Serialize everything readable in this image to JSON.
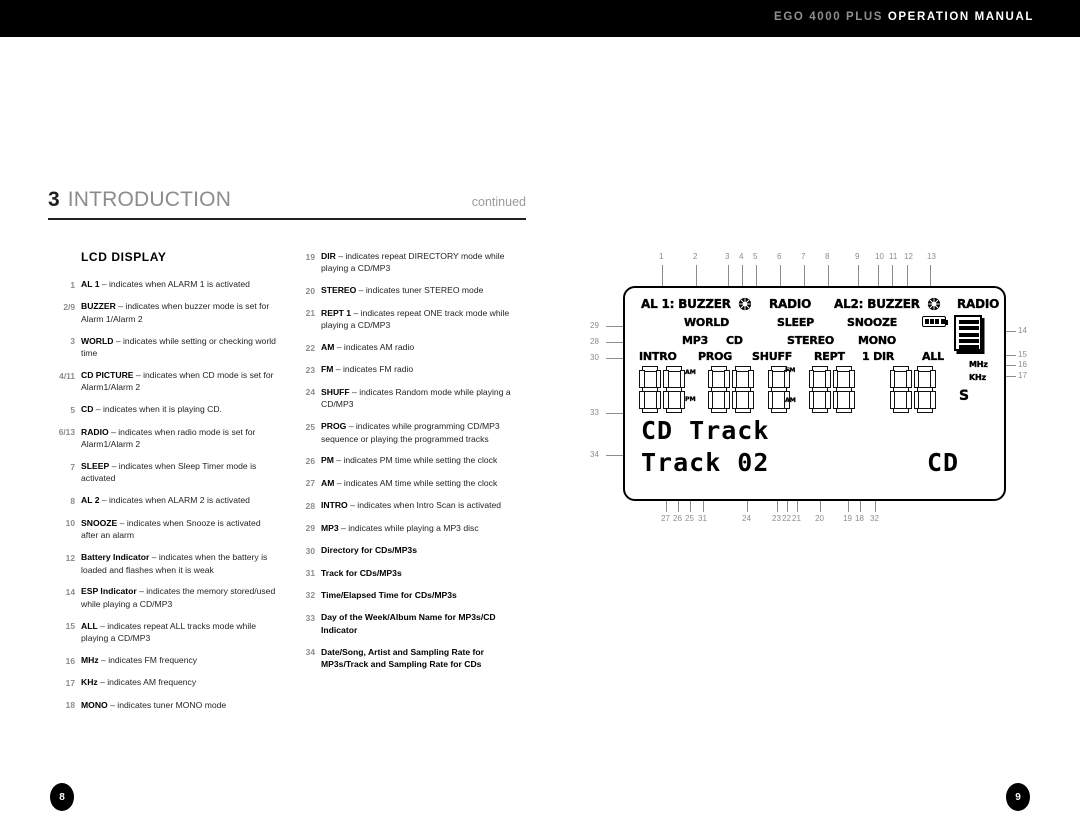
{
  "header": {
    "brand": "EGO 4000 PLUS",
    "title": "OPERATION MANUAL"
  },
  "section": {
    "number": "3",
    "title": "INTRODUCTION",
    "continued": "continued"
  },
  "left_column": {
    "heading": "LCD DISPLAY",
    "items": [
      {
        "num": "1",
        "term": "AL 1",
        "rest": " – indicates when ALARM 1 is activated"
      },
      {
        "num": "2/9",
        "term": "BUZZER",
        "rest": " – indicates when buzzer mode is set for Alarm 1/Alarm 2"
      },
      {
        "num": "3",
        "term": "WORLD",
        "rest": " – indicates while setting or checking world time"
      },
      {
        "num": "4/11",
        "term": "CD PICTURE",
        "rest": " – indicates when CD mode is set for Alarm1/Alarm 2"
      },
      {
        "num": "5",
        "term": "CD",
        "rest": " – indicates when it is playing CD."
      },
      {
        "num": "6/13",
        "term": "RADIO",
        "rest": " – indicates when radio mode is set for Alarm1/Alarm 2"
      },
      {
        "num": "7",
        "term": "SLEEP",
        "rest": " – indicates when Sleep Timer mode is activated"
      },
      {
        "num": "8",
        "term": "AL 2",
        "rest": " – indicates when ALARM 2 is activated"
      },
      {
        "num": "10",
        "term": "SNOOZE",
        "rest": " – indicates when Snooze is activated after an alarm"
      },
      {
        "num": "12",
        "term": "Battery Indicator",
        "rest": " – indicates when the battery is loaded and flashes when it is weak"
      },
      {
        "num": "14",
        "term": "ESP Indicator",
        "rest": " – indicates the memory stored/used while playing a CD/MP3"
      },
      {
        "num": "15",
        "term": "ALL",
        "rest": " – indicates repeat ALL tracks mode while playing a CD/MP3"
      },
      {
        "num": "16",
        "term": "MHz",
        "rest": " – indicates FM frequency"
      },
      {
        "num": "17",
        "term": "KHz",
        "rest": " – indicates AM frequency"
      },
      {
        "num": "18",
        "term": "MONO",
        "rest": " – indicates tuner MONO mode"
      }
    ]
  },
  "middle_column": {
    "items": [
      {
        "num": "19",
        "term": "DIR",
        "rest": " – indicates repeat DIRECTORY mode while playing a CD/MP3"
      },
      {
        "num": "20",
        "term": "STEREO",
        "rest": " – indicates tuner STEREO mode"
      },
      {
        "num": "21",
        "term": "REPT 1",
        "rest": " – indicates repeat ONE track mode while playing a CD/MP3"
      },
      {
        "num": "22",
        "term": "AM",
        "rest": " – indicates AM radio"
      },
      {
        "num": "23",
        "term": "FM",
        "rest": " – indicates FM radio"
      },
      {
        "num": "24",
        "term": "SHUFF",
        "rest": " – indicates Random mode while playing a CD/MP3"
      },
      {
        "num": "25",
        "term": "PROG",
        "rest": " – indicates while programming CD/MP3 sequence or playing the programmed tracks"
      },
      {
        "num": "26",
        "term": "PM",
        "rest": " – indicates PM time while setting the clock"
      },
      {
        "num": "27",
        "term": "AM",
        "rest": " – indicates AM time while setting the clock"
      },
      {
        "num": "28",
        "term": "INTRO",
        "rest": " – indicates when Intro Scan is activated"
      },
      {
        "num": "29",
        "term": "MP3",
        "rest": " – indicates while playing a MP3 disc"
      },
      {
        "num": "30",
        "term": "Directory for CDs/MP3s",
        "rest": ""
      },
      {
        "num": "31",
        "term": "Track for CDs/MP3s",
        "rest": ""
      },
      {
        "num": "32",
        "term": "Time/Elapsed Time for CDs/MP3s",
        "rest": ""
      },
      {
        "num": "33",
        "term": "Day of the Week/Album Name for MP3s/CD Indicator",
        "rest": ""
      },
      {
        "num": "34",
        "term": "Date/Song, Artist and Sampling Rate for MP3s/Track and Sampling Rate for CDs",
        "rest": ""
      }
    ]
  },
  "lcd_diagram": {
    "callouts_top": [
      "1",
      "2",
      "3",
      "4",
      "5",
      "6",
      "7",
      "8",
      "9",
      "10",
      "11",
      "12",
      "13"
    ],
    "callouts_left": [
      "29",
      "28",
      "30",
      "33",
      "34"
    ],
    "callouts_right": [
      "14",
      "15",
      "16",
      "17"
    ],
    "callouts_bottom": [
      "27",
      "26",
      "25",
      "31",
      "24",
      "23",
      "22",
      "21",
      "20",
      "19",
      "18",
      "32"
    ],
    "row1": {
      "al1": "AL 1: BUZZER",
      "radio1": "RADIO",
      "al2": "AL2: BUZZER",
      "radio2": "RADIO"
    },
    "row2": {
      "world": "WORLD",
      "sleep": "SLEEP",
      "snooze": "SNOOZE"
    },
    "row3": {
      "mp3": "MP3",
      "cd": "CD",
      "stereo": "STEREO",
      "mono": "MONO"
    },
    "row4": {
      "intro": "INTRO",
      "prog": "PROG",
      "shuff": "SHUFF",
      "rept": "REPT",
      "dir": "1 DIR",
      "all": "ALL"
    },
    "freq": {
      "mhz": "MHz",
      "khz": "KHz"
    },
    "segment_tags": {
      "am_top": "AM",
      "pm": "PM",
      "fm": "FM",
      "am_low": "AM",
      "seconds": "S"
    },
    "matrix_line1": "CD Track",
    "matrix_line2": "Track 02",
    "matrix_right": "CD"
  },
  "footer": {
    "left_page": "8",
    "right_page": "9"
  },
  "colors": {
    "ink": "#231f20",
    "gray": "#8c8c8c",
    "bar": "#000000"
  }
}
